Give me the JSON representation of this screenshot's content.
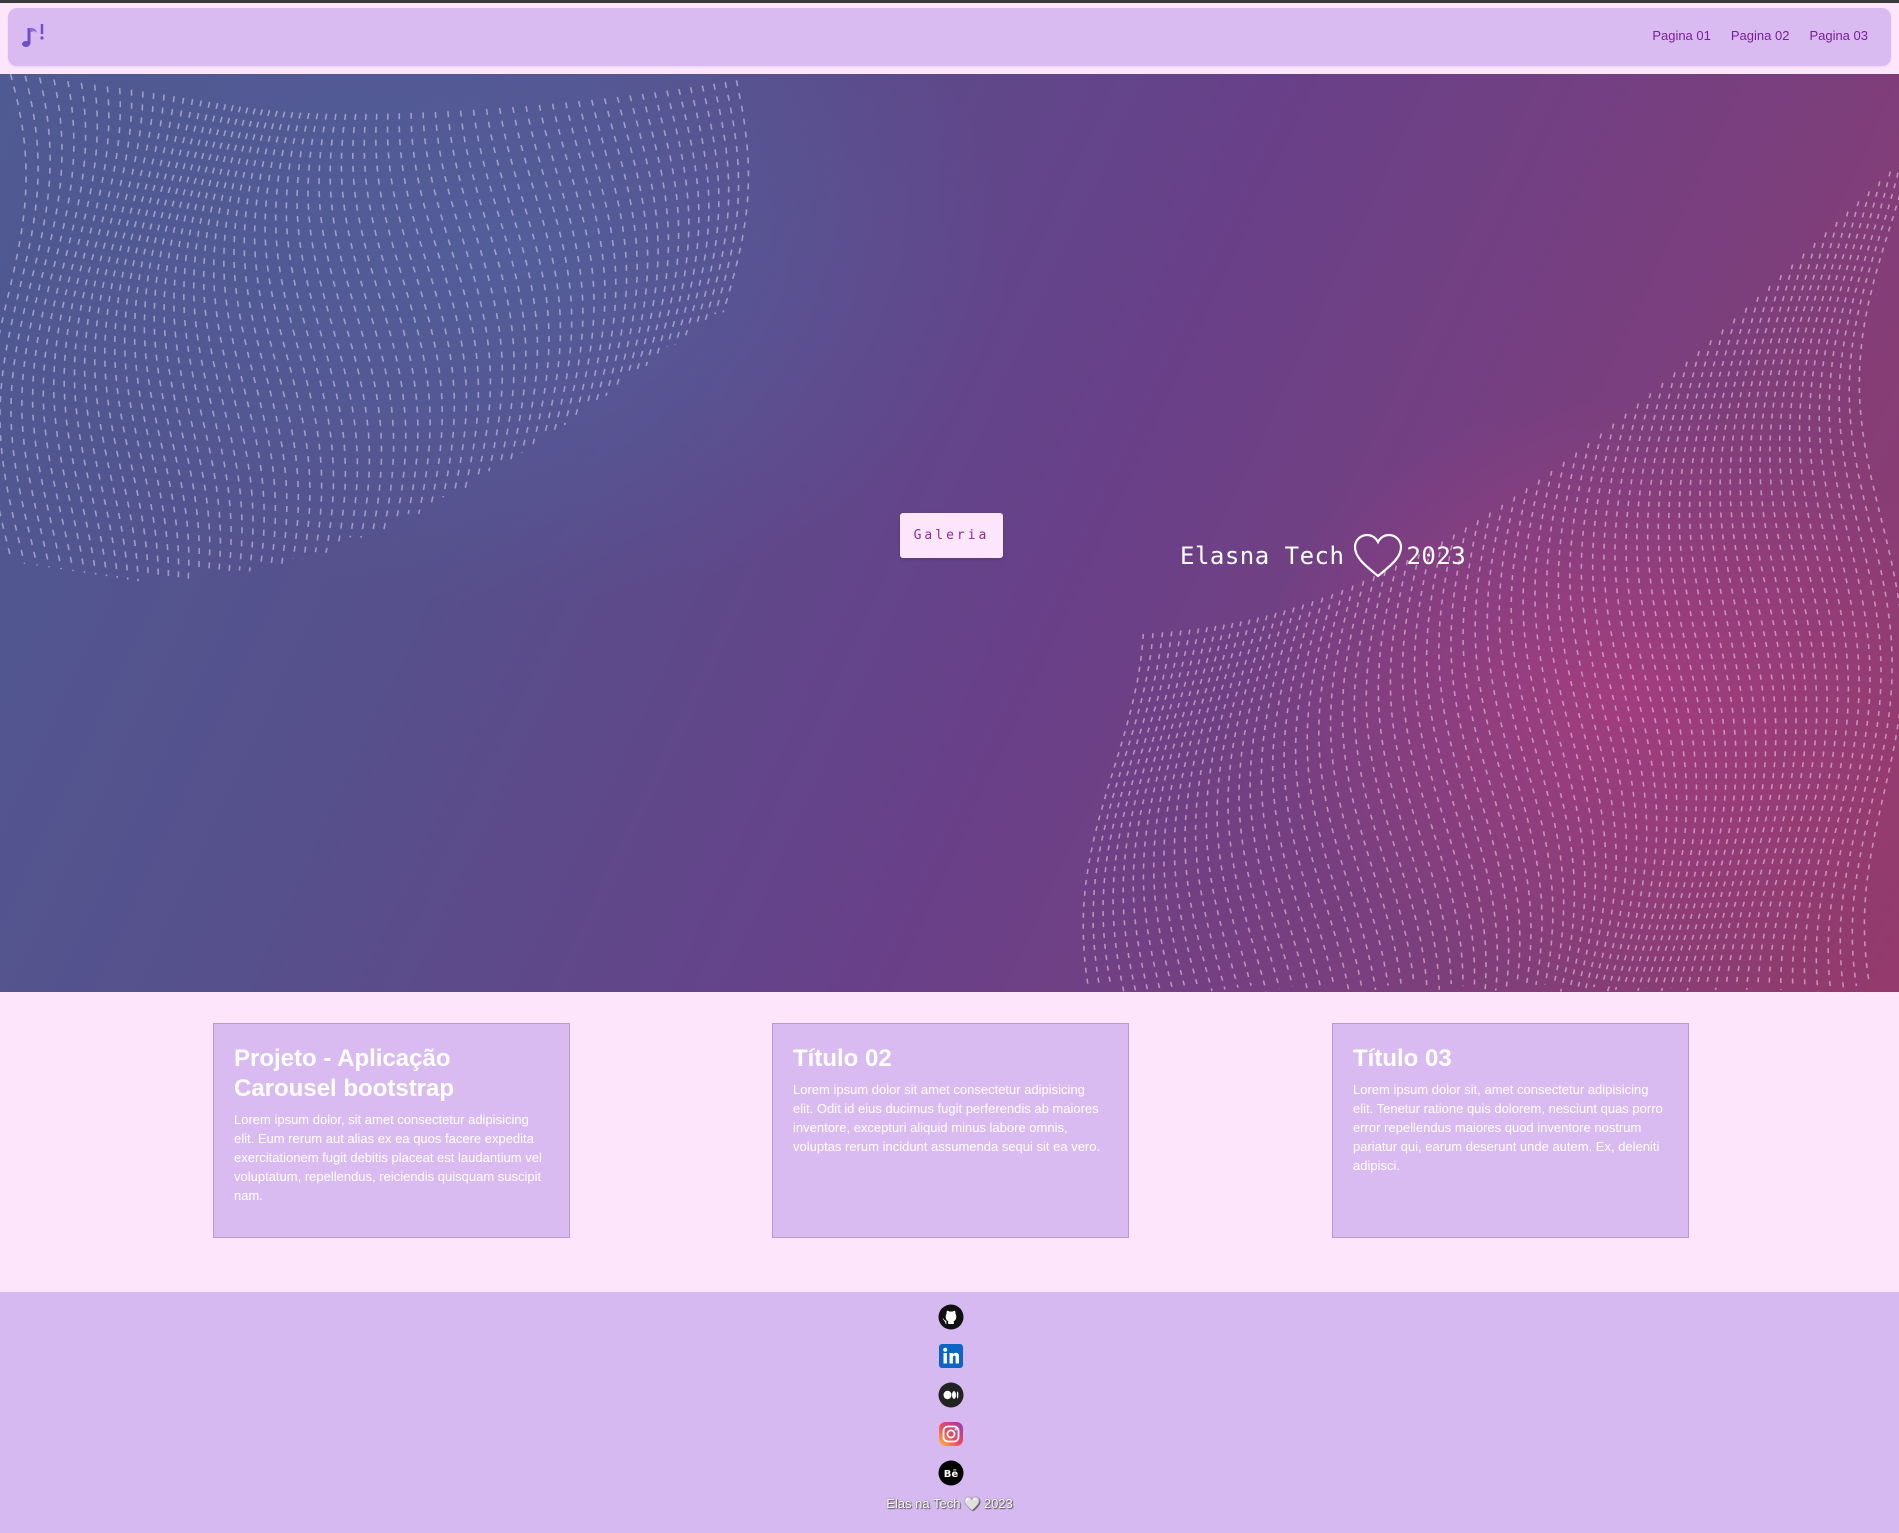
{
  "navbar": {
    "logo_icon": "music-note-logo-icon",
    "links": [
      "Pagina 01",
      "Pagina 02",
      "Pagina 03"
    ]
  },
  "hero": {
    "button_label": "Galeria",
    "caption_left": "Elasna Tech",
    "caption_icon": "heart-outline-icon",
    "caption_right": "2023"
  },
  "cards": [
    {
      "title": "Projeto - Aplicação Carousel bootstrap",
      "text": "Lorem ipsum dolor, sit amet consectetur adipisicing elit. Eum rerum aut alias ex ea quos facere expedita exercitationem fugit debitis placeat est laudantium vel voluptatum, repellendus, reiciendis quisquam suscipit nam."
    },
    {
      "title": "Título 02",
      "text": "Lorem ipsum dolor sit amet consectetur adipisicing elit. Odit id eius ducimus fugit perferendis ab maiores inventore, excepturi aliquid minus labore omnis, voluptas rerum incidunt assumenda sequi sit ea vero."
    },
    {
      "title": "Título 03",
      "text": "Lorem ipsum dolor sit, amet consectetur adipisicing elit. Tenetur ratione quis dolorem, nesciunt quas porro error repellendus maiores quod inventore nostrum pariatur qui, earum deserunt unde autem. Ex, deleniti adipisci."
    }
  ],
  "footer": {
    "social_icons": [
      "github-icon",
      "linkedin-icon",
      "medium-icon",
      "instagram-icon",
      "behance-icon"
    ],
    "text": "Elas na Tech 🤍 2023"
  },
  "colors": {
    "page_bg": "#fde6fc",
    "navbar_bg": "#d9bbf2",
    "link": "#7a1f9a",
    "card_bg": "#d9bbf2",
    "footer_bg": "#d7b9f1"
  }
}
